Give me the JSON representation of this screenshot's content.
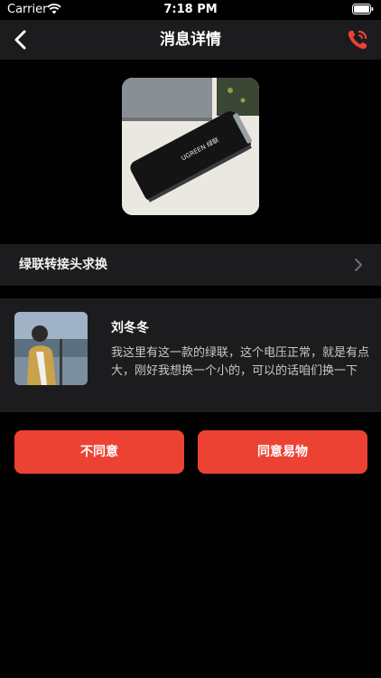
{
  "status_bar": {
    "carrier": "Carrier",
    "time": "7:18 PM"
  },
  "nav": {
    "title": "消息详情",
    "back_icon": "chevron-left-icon",
    "call_icon": "phone-call-icon",
    "accent_color": "#eb4234"
  },
  "product": {
    "image_label": "UGREEN 绿联"
  },
  "request": {
    "title": "绿联转接头求换"
  },
  "message": {
    "sender": "刘冬冬",
    "text": "我这里有这一款的绿联，这个电压正常，就是有点大，刚好我想换一个小的，可以的话咱们换一下"
  },
  "actions": {
    "decline_label": "不同意",
    "accept_label": "同意易物"
  }
}
